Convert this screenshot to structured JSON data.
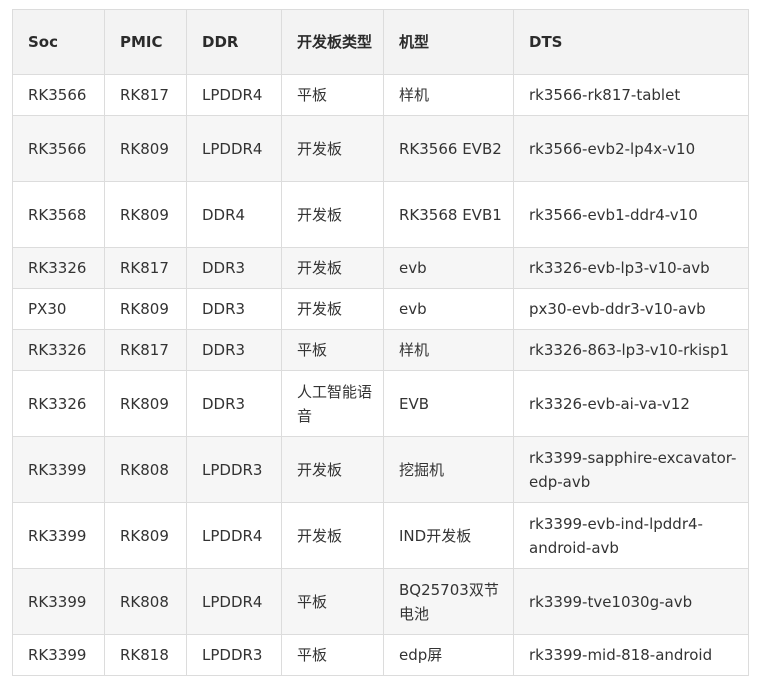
{
  "table": {
    "headers": [
      "Soc",
      "PMIC",
      "DDR",
      "开发板类型",
      "机型",
      "DTS"
    ],
    "rows": [
      [
        "RK3566",
        "RK817",
        "LPDDR4",
        "平板",
        "样机",
        "rk3566-rk817-tablet"
      ],
      [
        "RK3566",
        "RK809",
        "LPDDR4",
        "开发板",
        "RK3566 EVB2",
        "rk3566-evb2-lp4x-v10"
      ],
      [
        "RK3568",
        "RK809",
        "DDR4",
        "开发板",
        "RK3568 EVB1",
        "rk3566-evb1-ddr4-v10"
      ],
      [
        "RK3326",
        "RK817",
        "DDR3",
        "开发板",
        "evb",
        "rk3326-evb-lp3-v10-avb"
      ],
      [
        "PX30",
        "RK809",
        "DDR3",
        "开发板",
        "evb",
        "px30-evb-ddr3-v10-avb"
      ],
      [
        "RK3326",
        "RK817",
        "DDR3",
        "平板",
        "样机",
        "rk3326-863-lp3-v10-rkisp1"
      ],
      [
        "RK3326",
        "RK809",
        "DDR3",
        "人工智能语音",
        "EVB",
        "rk3326-evb-ai-va-v12"
      ],
      [
        "RK3399",
        "RK808",
        "LPDDR3",
        "开发板",
        "挖掘机",
        "rk3399-sapphire-excavator-edp-avb"
      ],
      [
        "RK3399",
        "RK809",
        "LPDDR4",
        "开发板",
        "IND开发板",
        "rk3399-evb-ind-lpddr4-android-avb"
      ],
      [
        "RK3399",
        "RK808",
        "LPDDR4",
        "平板",
        "BQ25703双节电池",
        "rk3399-tve1030g-avb"
      ],
      [
        "RK3399",
        "RK818",
        "LPDDR3",
        "平板",
        "edp屏",
        "rk3399-mid-818-android"
      ]
    ]
  }
}
